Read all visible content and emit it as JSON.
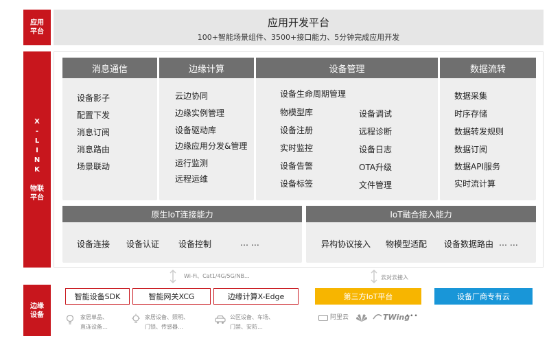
{
  "left_labels": {
    "app_platform": "应用\n平台",
    "xlink": [
      "X",
      "-",
      "L",
      "I",
      "N",
      "K"
    ],
    "iot_platform": "物联\n平台",
    "edge_device": "边缘\n设备"
  },
  "top": {
    "title": "应用开发平台",
    "subtitle": "100+智能场景组件、3500+接口能力、5分钟完成应用开发"
  },
  "modules": {
    "messaging": {
      "header": "消息通信",
      "items": [
        "设备影子",
        "配置下发",
        "消息订阅",
        "消息路由",
        "场景联动"
      ]
    },
    "edge": {
      "header": "边缘计算",
      "items": [
        "云边协同",
        "边缘实例管理",
        "设备驱动库",
        "边缘应用分发&管理",
        "运行监测",
        "远程运维"
      ]
    },
    "device": {
      "header": "设备管理",
      "top_item": "设备生命周期管理",
      "left": [
        "物模型库",
        "设备注册",
        "实时监控",
        "设备告警",
        "设备标签"
      ],
      "right": [
        "设备调试",
        "远程诊断",
        "设备日志",
        "OTA升级",
        "文件管理"
      ]
    },
    "data": {
      "header": "数据流转",
      "items": [
        "数据采集",
        "时序存储",
        "数据转发规则",
        "数据订阅",
        "数据API服务",
        "实时流计算"
      ]
    }
  },
  "capabilities": {
    "native": {
      "header": "原生IoT连接能力",
      "items": [
        "设备连接",
        "设备认证",
        "设备控制",
        "… …"
      ]
    },
    "fusion": {
      "header": "IoT融合接入能力",
      "items": [
        "异构协议接入",
        "物模型适配",
        "设备数据路由",
        "… …"
      ]
    }
  },
  "connectors": {
    "left": "Wi-Fi、Cat1/4G/5G/NB…",
    "right": "云对云接入"
  },
  "edge_row": {
    "sdk": "智能设备SDK",
    "gateway": "智能网关XCG",
    "xedge": "边缘计算X-Edge",
    "third_party": "第三方IoT平台",
    "vendor_cloud": "设备厂商专有云",
    "sdk_desc": [
      "家居单品、",
      "直连设备…"
    ],
    "gateway_desc": [
      "家居设备、照明、",
      "门锁、传感器…"
    ],
    "xedge_desc": [
      "公区设备、车场、",
      "门禁、安防…"
    ],
    "cloud_logos": [
      "阿里云",
      "TWing",
      "• • •"
    ],
    "colors": {
      "red": "#c8161d",
      "yellow": "#f7b500",
      "blue": "#1996d8",
      "header_gray": "#6f6f6f"
    }
  }
}
